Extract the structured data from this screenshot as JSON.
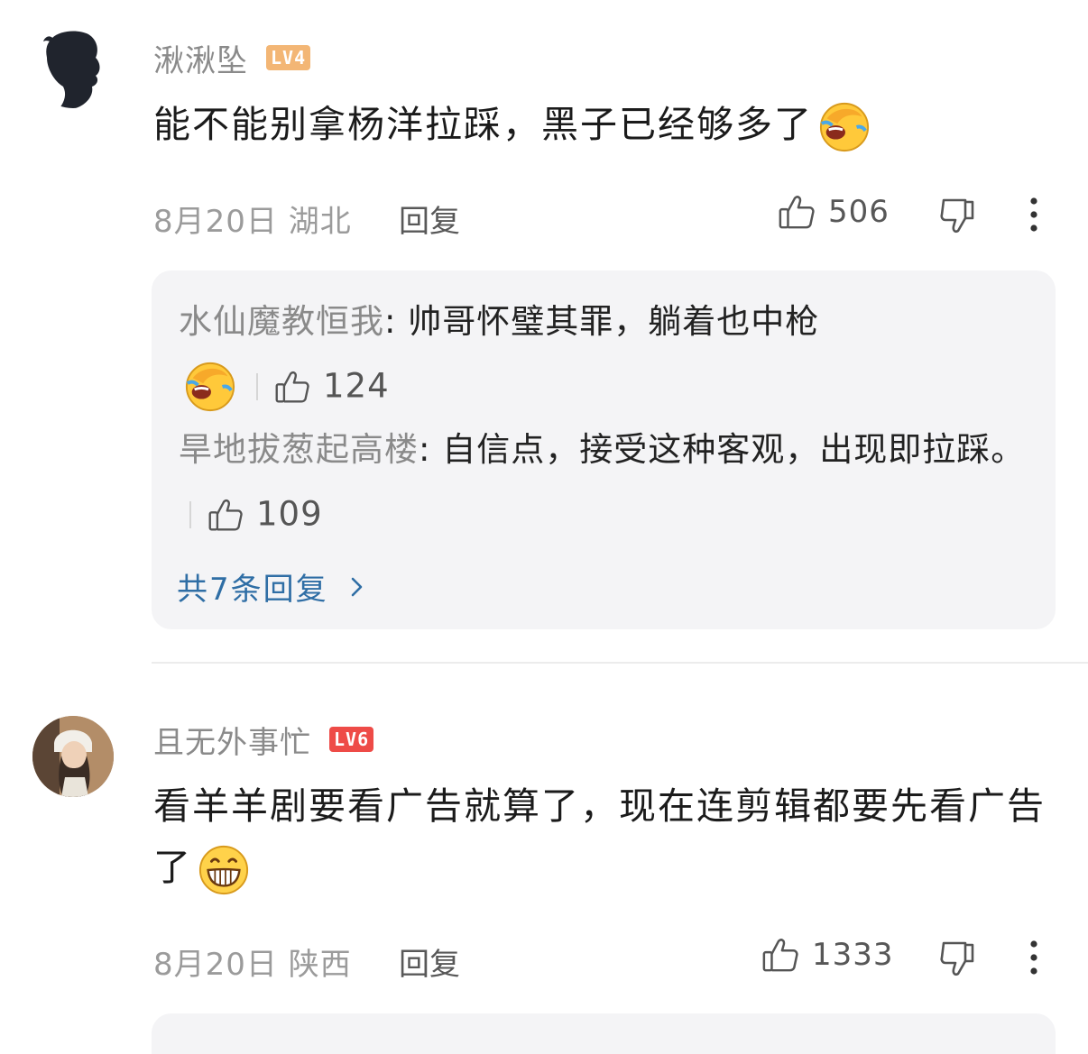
{
  "comments": [
    {
      "username": "湫湫坠",
      "level": "LV4",
      "text": "能不能别拿杨洋拉踩，黑子已经够多了",
      "date_location": "8月20日 湖北",
      "reply_label": "回复",
      "likes": "506",
      "replies": [
        {
          "name": "水仙魔教恒我",
          "colon": ": ",
          "text": "帅哥怀璧其罪，躺着也中枪",
          "likes": "124"
        },
        {
          "name": "旱地拔葱起高楼",
          "colon": ": ",
          "text": "自信点，接受这种客观，出现即拉踩。",
          "likes": "109"
        }
      ],
      "view_all": "共7条回复"
    },
    {
      "username": "且无外事忙",
      "level": "LV6",
      "text": "看羊羊剧要看广告就算了，现在连剪辑都要先看广告了",
      "date_location": "8月20日 陕西",
      "reply_label": "回复",
      "likes": "1333"
    }
  ],
  "icons": {
    "like": "thumb-up-icon",
    "dislike": "thumb-down-icon",
    "more": "more-vertical-icon",
    "chevron": "chevron-right-icon",
    "emoji_laugh_cry": "laughing-crying-emoji",
    "emoji_grin": "grinning-emoji"
  },
  "colors": {
    "lv4": "#f3b675",
    "lv6": "#ee4b47",
    "link": "#2f6ea5",
    "reply_bg": "#f4f4f6"
  }
}
